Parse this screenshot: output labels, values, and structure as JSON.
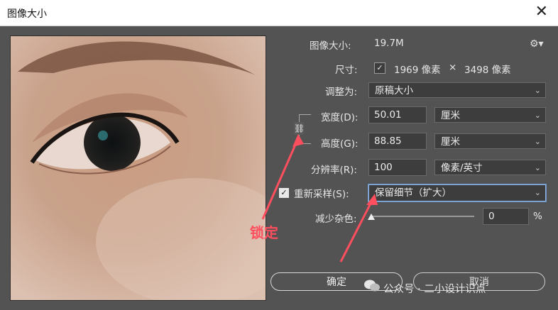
{
  "window": {
    "title": "图像大小",
    "close_glyph": "✕"
  },
  "info": {
    "size_label": "图像大小:",
    "size_value": "19.7M"
  },
  "dimensions": {
    "label": "尺寸:",
    "width_px": "1969 像素",
    "times": "×",
    "height_px": "3498 像素"
  },
  "fit": {
    "label": "调整为:",
    "value": "原稿大小"
  },
  "width": {
    "label": "宽度(D):",
    "value": "50.01",
    "unit": "厘米"
  },
  "height": {
    "label": "高度(G):",
    "value": "88.85",
    "unit": "厘米"
  },
  "resolution": {
    "label": "分辨率(R):",
    "value": "100",
    "unit": "像素/英寸"
  },
  "resample": {
    "label": "重新采样(S):",
    "checked": true,
    "method": "保留细节（扩大）"
  },
  "noise": {
    "label": "减少杂色:",
    "value": "0",
    "unit": "%",
    "level": 0
  },
  "buttons": {
    "ok": "确定",
    "cancel": "取消"
  },
  "annotation": {
    "text": "锁定",
    "color": "#ff4f5e"
  },
  "watermark": {
    "text": "公众号 · 二小设计识点"
  },
  "icons": {
    "gear": "gear-icon",
    "chain": "link-icon",
    "dropdown": "chevron-down-icon"
  },
  "colors": {
    "dialog_bg": "#535353",
    "field_bg": "#3d3d3d",
    "focus": "#8fb3e0"
  }
}
